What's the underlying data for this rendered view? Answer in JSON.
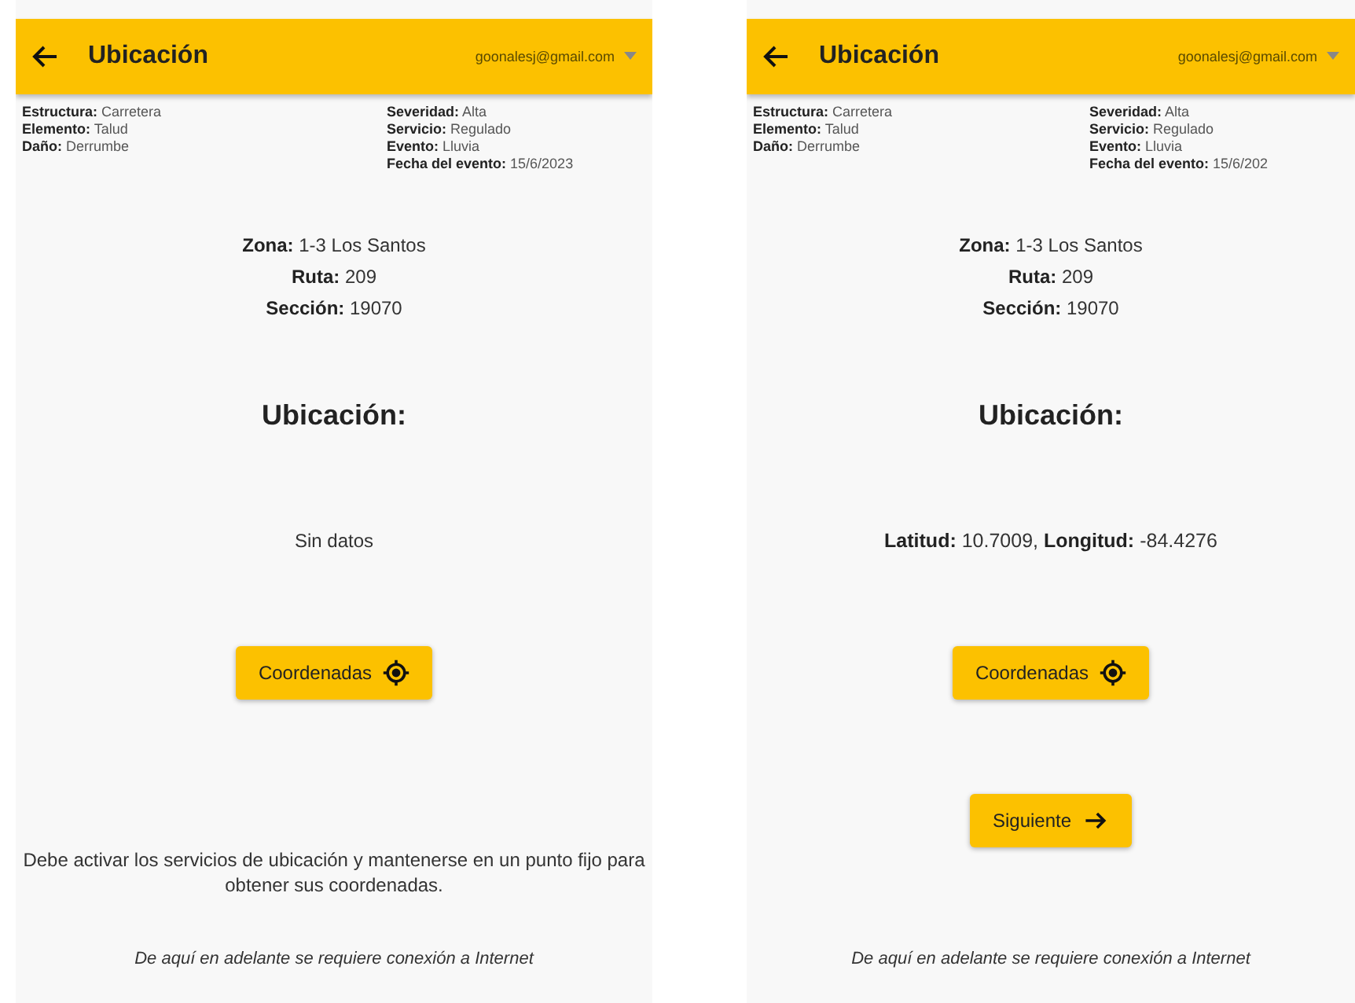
{
  "screens": [
    {
      "header": {
        "title": "Ubicación",
        "account": "goonalesj@gmail.com"
      },
      "info_left": [
        "**Estructura:** Carretera",
        "**Elemento:** Talud",
        "**Daño:** Derrumbe"
      ],
      "info_right": [
        "**Severidad:** Alta",
        "**Servicio:** Regulado",
        "**Evento:** Lluvia",
        "**Fecha del evento:** 15/6/2023"
      ],
      "location": [
        "**Zona:** 1-3 Los Santos",
        "**Ruta:** 209",
        "**Sección:** 19070"
      ],
      "heading": "Ubicación:",
      "body": [
        {
          "kind": "text",
          "text": "Sin datos"
        },
        {
          "kind": "locate_button",
          "label": "Coordenadas"
        },
        {
          "kind": "note",
          "text": "Debe activar los servicios de ubicación y mantenerse en un punto fijo para obtener sus coordenadas."
        }
      ],
      "footer": "De aquí en adelante se requiere conexión a Internet"
    },
    {
      "header": {
        "title": "Ubicación",
        "account": "goonalesj@gmail.com"
      },
      "info_left": [
        "**Estructura:** Carretera",
        "**Elemento:** Talud",
        "**Daño:** Derrumbe"
      ],
      "info_right": [
        "**Severidad:** Alta",
        "**Servicio:** Regulado",
        "**Evento:** Lluvia",
        "**Fecha del evento:** 15/6/202"
      ],
      "location": [
        "**Zona:** 1-3 Los Santos",
        "**Ruta:** 209",
        "**Sección:** 19070"
      ],
      "heading": "Ubicación:",
      "body": [
        {
          "kind": "text",
          "text": "**Latitud:** 10.7009,  **Longitud:** -84.4276"
        },
        {
          "kind": "locate_button",
          "label": "Coordenadas"
        },
        {
          "kind": "next_button",
          "label": "Siguiente"
        }
      ],
      "footer": "De aquí en adelante se requiere conexión a Internet"
    }
  ]
}
